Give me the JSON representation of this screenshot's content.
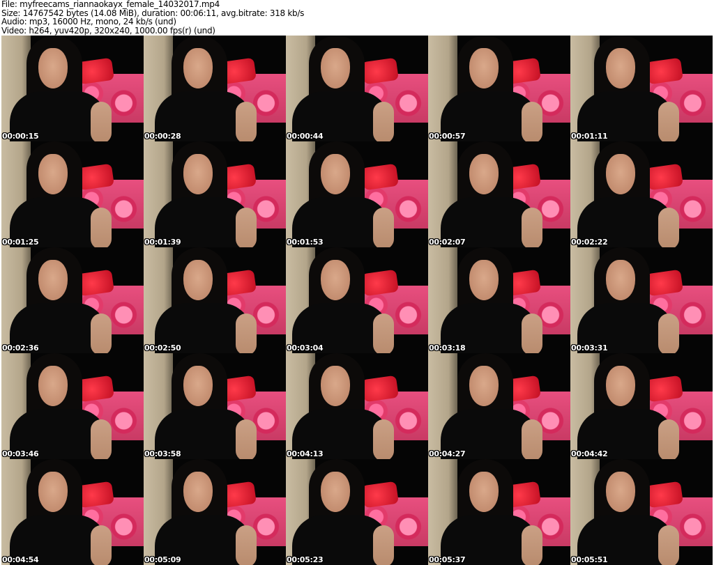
{
  "header": {
    "file": "File: myfreecams_riannaokayx_female_14032017.mp4",
    "size": "Size: 14767542 bytes (14.08 MiB), duration: 00:06:11, avg.bitrate: 318 kb/s",
    "audio": "Audio: mp3, 16000 Hz, mono, 24 kb/s (und)",
    "video": "Video: h264, yuv420p, 320x240, 1000.00 fps(r) (und)"
  },
  "thumbnails": [
    "00:00:15",
    "00:00:28",
    "00:00:44",
    "00:00:57",
    "00:01:11",
    "00:01:25",
    "00:01:39",
    "00:01:53",
    "00:02:07",
    "00:02:22",
    "00:02:36",
    "00:02:50",
    "00:03:04",
    "00:03:18",
    "00:03:31",
    "00:03:46",
    "00:03:58",
    "00:04:13",
    "00:04:27",
    "00:04:42",
    "00:04:54",
    "00:05:09",
    "00:05:23",
    "00:05:37",
    "00:05:51"
  ]
}
